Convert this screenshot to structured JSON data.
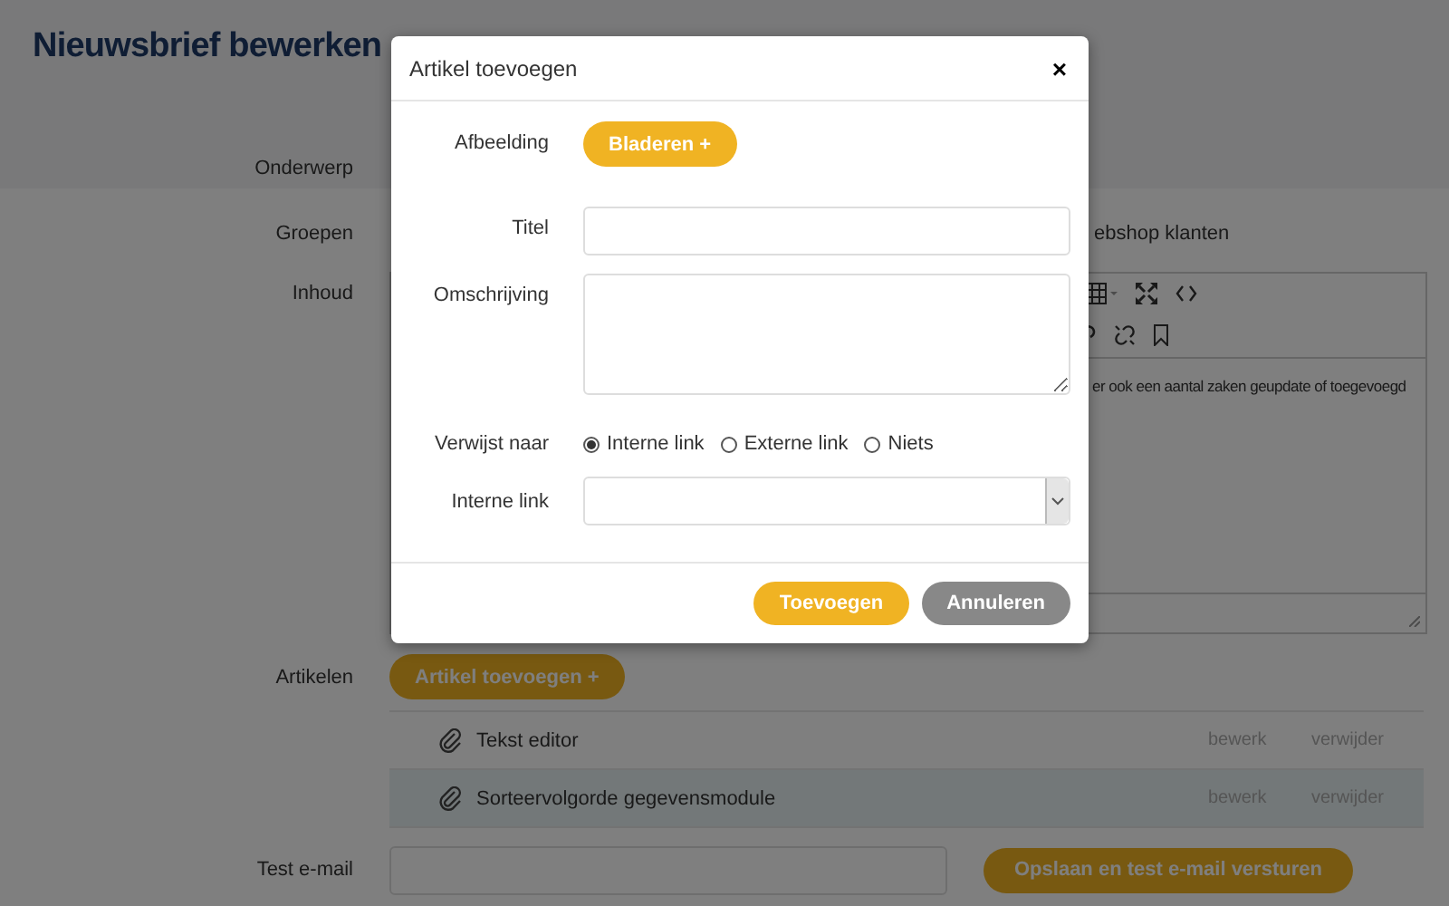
{
  "page": {
    "title": "Nieuwsbrief bewerken",
    "subject": {
      "label": "Onderwerp"
    },
    "groups": {
      "label": "Groepen",
      "visible_option": "ebshop klanten"
    },
    "content": {
      "label": "Inhoud",
      "text": "er ook een aantal zaken geupdate of toegevoegd"
    },
    "articles": {
      "label": "Artikelen",
      "add_button": "Artikel toevoegen +",
      "items": [
        {
          "title": "Tekst editor",
          "edit": "bewerk",
          "delete": "verwijder",
          "selected": false
        },
        {
          "title": "Sorteervolgorde gegevensmodule",
          "edit": "bewerk",
          "delete": "verwijder",
          "selected": true
        }
      ]
    },
    "test_email": {
      "label": "Test e-mail",
      "button": "Opslaan en test e-mail versturen"
    }
  },
  "dialog": {
    "title": "Artikel toevoegen",
    "close": "×",
    "fields": [
      {
        "kind": "button",
        "label": "Afbeelding",
        "button": "Bladeren +"
      },
      {
        "kind": "text",
        "label": "Titel"
      },
      {
        "kind": "textarea",
        "label": "Omschrijving"
      },
      {
        "kind": "radio",
        "label": "Verwijst naar",
        "options": [
          {
            "label": "Interne link",
            "selected": true
          },
          {
            "label": "Externe link",
            "selected": false
          },
          {
            "label": "Niets",
            "selected": false
          }
        ]
      },
      {
        "kind": "select",
        "label": "Interne link"
      }
    ],
    "buttons": [
      {
        "kind": "primary",
        "label": "Toevoegen"
      },
      {
        "kind": "secondary",
        "label": "Annuleren"
      }
    ]
  }
}
